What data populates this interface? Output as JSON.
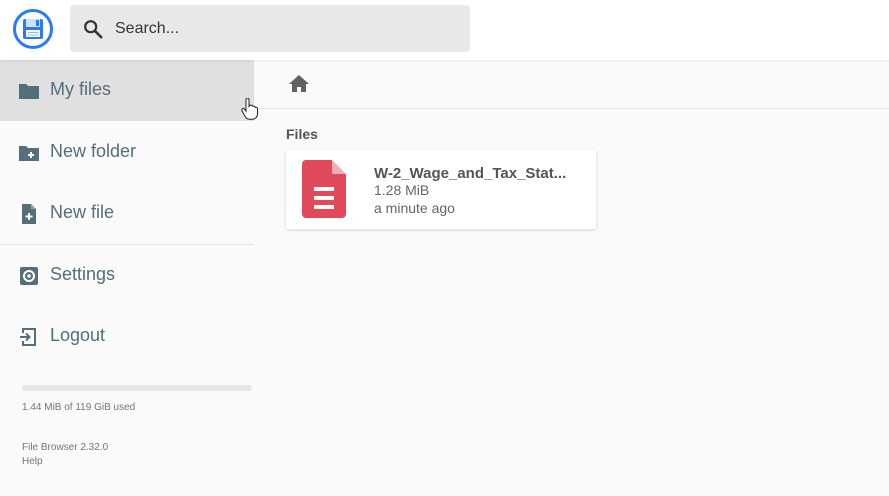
{
  "header": {
    "search": {
      "placeholder": "Search..."
    }
  },
  "sidebar": {
    "items": [
      {
        "label": "My files",
        "icon": "folder-icon",
        "active": true
      },
      {
        "label": "New folder",
        "icon": "folder-plus-icon"
      },
      {
        "label": "New file",
        "icon": "file-plus-icon"
      },
      {
        "label": "Settings",
        "icon": "gear-icon"
      },
      {
        "label": "Logout",
        "icon": "logout-icon"
      }
    ],
    "usage": {
      "text": "1.44 MiB of 119 GiB used",
      "fraction": 1.18e-05
    },
    "version": "File Browser 2.32.0",
    "help": "Help"
  },
  "main": {
    "breadcrumb_icon": "home-icon",
    "section_title": "Files",
    "files": [
      {
        "name": "W-2_Wage_and_Tax_Stat...",
        "size": "1.28 MiB",
        "modified": "a minute ago",
        "icon": "document-icon",
        "icon_color": "#e04a5a"
      }
    ]
  },
  "colors": {
    "accent": "#2979ff",
    "sidebar_text": "#546e7a",
    "active_bg": "#e0e0e0"
  }
}
